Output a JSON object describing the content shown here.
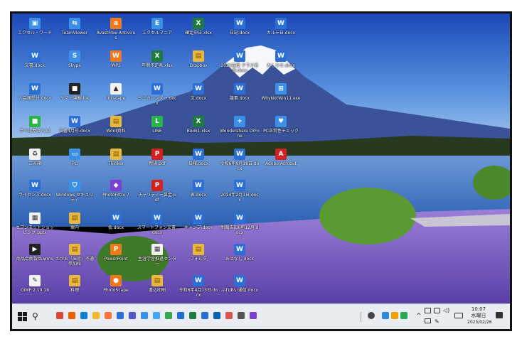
{
  "desktop": {
    "icons": [
      {
        "label": "エクセル・ワード",
        "kind": "app",
        "glyph": "▣"
      },
      {
        "label": "TeamViewer",
        "kind": "app",
        "glyph": "⇆"
      },
      {
        "label": "AvastFree Antivirus",
        "kind": "orange",
        "glyph": "a"
      },
      {
        "label": "エクセルマニア",
        "kind": "app",
        "glyph": "E"
      },
      {
        "label": "確定申告.xlsx",
        "kind": "excel",
        "glyph": "X"
      },
      {
        "label": "日記.docx",
        "kind": "word",
        "glyph": "W"
      },
      {
        "label": "カルテ日.docx",
        "kind": "word",
        "glyph": "W"
      },
      {
        "label": "文書.docx",
        "kind": "word",
        "glyph": "W"
      },
      {
        "label": "Skype",
        "kind": "app",
        "glyph": "S"
      },
      {
        "label": "WPS",
        "kind": "orange",
        "glyph": "W"
      },
      {
        "label": "年間予定表.xlsx",
        "kind": "excel",
        "glyph": "X"
      },
      {
        "label": "Dropbox",
        "kind": "folder",
        "glyph": "▤"
      },
      {
        "label": "2022年度 クラス名簿.docx",
        "kind": "word",
        "glyph": "W"
      },
      {
        "label": "おしらせ.docx",
        "kind": "word",
        "glyph": "W"
      },
      {
        "label": "入会届受付.docx",
        "kind": "word",
        "glyph": "W"
      },
      {
        "label": "ヤマト運輸.lnk",
        "kind": "dark",
        "glyph": "■"
      },
      {
        "label": "Inkscape",
        "kind": "white",
        "glyph": "▲"
      },
      {
        "label": "ミニカレンダー.docx",
        "kind": "word",
        "glyph": "W"
      },
      {
        "label": "文.docx",
        "kind": "word",
        "glyph": "W"
      },
      {
        "label": "議事.docx",
        "kind": "word",
        "glyph": "W"
      },
      {
        "label": "WhyNotWin11.exe",
        "kind": "app",
        "glyph": "⊞"
      },
      {
        "label": "ラベル屋さん10",
        "kind": "green",
        "glyph": "■"
      },
      {
        "label": "文書4月号.docx",
        "kind": "word",
        "glyph": "W"
      },
      {
        "label": "Word資料",
        "kind": "folder",
        "glyph": "▤"
      },
      {
        "label": "LINE",
        "kind": "green",
        "glyph": "L"
      },
      {
        "label": "Book1.xlsx",
        "kind": "excel",
        "glyph": "X"
      },
      {
        "label": "Wondershare DrFone",
        "kind": "app",
        "glyph": "+"
      },
      {
        "label": "PC正常性チェック",
        "kind": "app",
        "glyph": "♥"
      },
      {
        "label": "ごみ箱",
        "kind": "white",
        "glyph": "♻"
      },
      {
        "label": "PC",
        "kind": "app",
        "glyph": "▭"
      },
      {
        "label": "Thinker",
        "kind": "folder",
        "glyph": "▤"
      },
      {
        "label": "新規.pdf",
        "kind": "pdf",
        "glyph": "P"
      },
      {
        "label": "日報.docx",
        "kind": "word",
        "glyph": "W"
      },
      {
        "label": "令和6年9月18日.docx",
        "kind": "word",
        "glyph": "W"
      },
      {
        "label": "Adobe Acrobat",
        "kind": "pdf",
        "glyph": "A"
      },
      {
        "label": "ライセンス.docx",
        "kind": "word",
        "glyph": "W"
      },
      {
        "label": "Windows セキュリティ",
        "kind": "app",
        "glyph": "⛉"
      },
      {
        "label": "PhotoFiltre 7",
        "kind": "purple",
        "glyph": "◆"
      },
      {
        "label": "チャリティー募金.pdf",
        "kind": "pdf",
        "glyph": "P"
      },
      {
        "label": "表.docx",
        "kind": "word",
        "glyph": "W"
      },
      {
        "label": "2024年2月1日.docx",
        "kind": "word",
        "glyph": "W"
      },
      {
        "label": "セブンネットショッピング.pptx",
        "kind": "white",
        "glyph": "▦"
      },
      {
        "label": "案内",
        "kind": "folder",
        "glyph": "▤"
      },
      {
        "label": "会.docx",
        "kind": "word",
        "glyph": "W"
      },
      {
        "label": "スマートフォン文書.docx",
        "kind": "word",
        "glyph": "W"
      },
      {
        "label": "キャンプ.docx",
        "kind": "word",
        "glyph": "W"
      },
      {
        "label": "新聞告知6年12月.docx",
        "kind": "word",
        "glyph": "W"
      },
      {
        "label": "商品会新製品.wmv",
        "kind": "dark",
        "glyph": "▶"
      },
      {
        "label": "えがお「出荷」不通 参加校",
        "kind": "folder",
        "glyph": "▤"
      },
      {
        "label": "PowerPoint",
        "kind": "orange",
        "glyph": "P"
      },
      {
        "label": "生涯学習推進センター",
        "kind": "white",
        "glyph": "▦"
      },
      {
        "label": "フォルダ",
        "kind": "folder",
        "glyph": "▤"
      },
      {
        "label": "おはなし.docx",
        "kind": "word",
        "glyph": "W"
      },
      {
        "label": "GIMP 2.10.18",
        "kind": "white",
        "glyph": "✎"
      },
      {
        "label": "料理",
        "kind": "folder",
        "glyph": "▤"
      },
      {
        "label": "PhotoScape",
        "kind": "orange",
        "glyph": "●"
      },
      {
        "label": "書込印刷",
        "kind": "folder",
        "glyph": "▤"
      },
      {
        "label": "令和6年4月13日.docx",
        "kind": "word",
        "glyph": "W"
      },
      {
        "label": "ふれあい通信.docx",
        "kind": "word",
        "glyph": "W"
      }
    ]
  },
  "taskbar": {
    "start_glyph": "",
    "search_glyph": "⚲",
    "pinned": [
      {
        "name": "chrome",
        "color": "#db4437"
      },
      {
        "name": "firefox",
        "color": "#e66000"
      },
      {
        "name": "edge",
        "color": "#0f7fd6"
      },
      {
        "name": "explorer",
        "color": "#f2b631"
      },
      {
        "name": "firefox2",
        "color": "#ff7139"
      },
      {
        "name": "word",
        "color": "#2b6fd6"
      },
      {
        "name": "teams",
        "color": "#5059c9"
      },
      {
        "name": "photos",
        "color": "#3a8fe6"
      },
      {
        "name": "paint",
        "color": "#41a5f5"
      },
      {
        "name": "chrome2",
        "color": "#34a853"
      },
      {
        "name": "mail",
        "color": "#1f6fd1"
      },
      {
        "name": "excel",
        "color": "#1f7a40"
      },
      {
        "name": "word2",
        "color": "#2b6fd6"
      },
      {
        "name": "outlook",
        "color": "#0a64ad"
      },
      {
        "name": "snip",
        "color": "#d9534f"
      },
      {
        "name": "settings",
        "color": "#555555"
      },
      {
        "name": "store",
        "color": "#7b3fd1"
      }
    ],
    "clock_time": "10:07",
    "clock_day": "水曜日",
    "clock_date": "2025/02/26"
  },
  "colors": {
    "taskbar_bg": "#e9ecf0",
    "sky_top": "#1a48b8",
    "lake": "#3b74c8",
    "lavender": "#7a58c8"
  }
}
